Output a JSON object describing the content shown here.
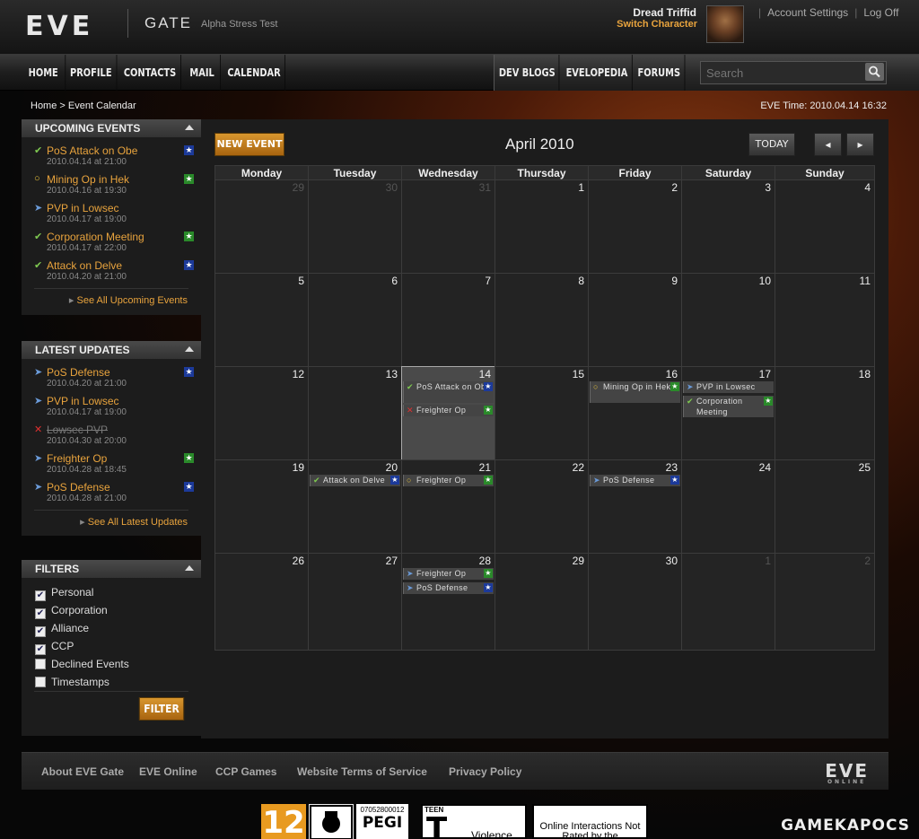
{
  "header": {
    "logo": "EVE",
    "site": "GATE",
    "subtitle": "Alpha Stress Test",
    "user_name": "Dread Triffid",
    "switch_character": "Switch Character",
    "account_settings": "Account Settings",
    "log_off": "Log Off",
    "separator": "|"
  },
  "nav": {
    "left": [
      "HOME",
      "PROFILE",
      "CONTACTS",
      "MAIL",
      "CALENDAR"
    ],
    "right": [
      "DEV BLOGS",
      "EVELOPEDIA",
      "FORUMS"
    ],
    "search_placeholder": "Search"
  },
  "breadcrumb": "Home > Event Calendar",
  "eve_time": "EVE Time: 2010.04.14 16:32",
  "upcoming": {
    "title": "UPCOMING EVENTS",
    "items": [
      {
        "title": "PoS Attack on Obe",
        "date": "2010.04.14 at 21:00"
      },
      {
        "title": "Mining Op in Hek",
        "date": "2010.04.16 at 19:30"
      },
      {
        "title": "PVP in Lowsec",
        "date": "2010.04.17 at 19:00"
      },
      {
        "title": "Corporation Meeting",
        "date": "2010.04.17 at 22:00"
      },
      {
        "title": "Attack on Delve",
        "date": "2010.04.20 at 21:00"
      }
    ],
    "see_all": "See All Upcoming Events"
  },
  "updates": {
    "title": "LATEST UPDATES",
    "items": [
      {
        "title": "PoS Defense",
        "date": "2010.04.20 at 21:00"
      },
      {
        "title": "PVP in Lowsec",
        "date": "2010.04.17 at 19:00"
      },
      {
        "title": "Lowsec PVP",
        "date": "2010.04.30 at 20:00"
      },
      {
        "title": "Freighter Op",
        "date": "2010.04.28 at 18:45"
      },
      {
        "title": "PoS Defense",
        "date": "2010.04.28 at 21:00"
      }
    ],
    "see_all": "See All Latest Updates"
  },
  "filters": {
    "title": "FILTERS",
    "items": [
      {
        "label": "Personal",
        "checked": true
      },
      {
        "label": "Corporation",
        "checked": true
      },
      {
        "label": "Alliance",
        "checked": true
      },
      {
        "label": "CCP",
        "checked": true
      },
      {
        "label": "Declined Events",
        "checked": false
      },
      {
        "label": "Timestamps",
        "checked": false
      }
    ],
    "button": "FILTER"
  },
  "calendar": {
    "new_event": "NEW EVENT",
    "month": "April 2010",
    "today": "TODAY",
    "days": [
      "Monday",
      "Tuesday",
      "Wednesday",
      "Thursday",
      "Friday",
      "Saturday",
      "Sunday"
    ],
    "weeks": [
      [
        "29",
        "30",
        "31",
        "1",
        "2",
        "3",
        "4"
      ],
      [
        "5",
        "6",
        "7",
        "8",
        "9",
        "10",
        "11"
      ],
      [
        "12",
        "13",
        "14",
        "15",
        "16",
        "17",
        "18"
      ],
      [
        "19",
        "20",
        "21",
        "22",
        "23",
        "24",
        "25"
      ],
      [
        "26",
        "27",
        "28",
        "29",
        "30",
        "1",
        "2"
      ]
    ],
    "events": {
      "e14a": "PoS Attack on Obe",
      "e14b": "Freighter Op",
      "e16": "Mining Op in Hek",
      "e17a": "PVP in Lowsec",
      "e17b": "Corporation Meeting",
      "e20": "Attack on Delve",
      "e21": "Freighter Op",
      "e23": "PoS Defense",
      "e28a": "Freighter Op",
      "e28b": "PoS Defense"
    }
  },
  "footer": {
    "links": [
      "About EVE Gate",
      "EVE Online",
      "CCP Games",
      "Website Terms of Service",
      "Privacy Policy"
    ],
    "logo": "EVE",
    "logo_sub": "ONLINE"
  },
  "ratings": {
    "age": "12",
    "pegi_code": "07052800012",
    "pegi": "PEGI",
    "esrb": "TEEN",
    "esrb_letter": "T",
    "esrb_desc": "Violence",
    "online": "Online Interactions Not Rated by the"
  },
  "watermark": "GAMEKAPOCS",
  "colors": {
    "accent": "#e8a33d",
    "check": "#7ec850",
    "pending": "#e8c23d",
    "declined": "#e03030",
    "blue_badge": "#1c3a9a",
    "green_badge": "#2a8a2a"
  }
}
